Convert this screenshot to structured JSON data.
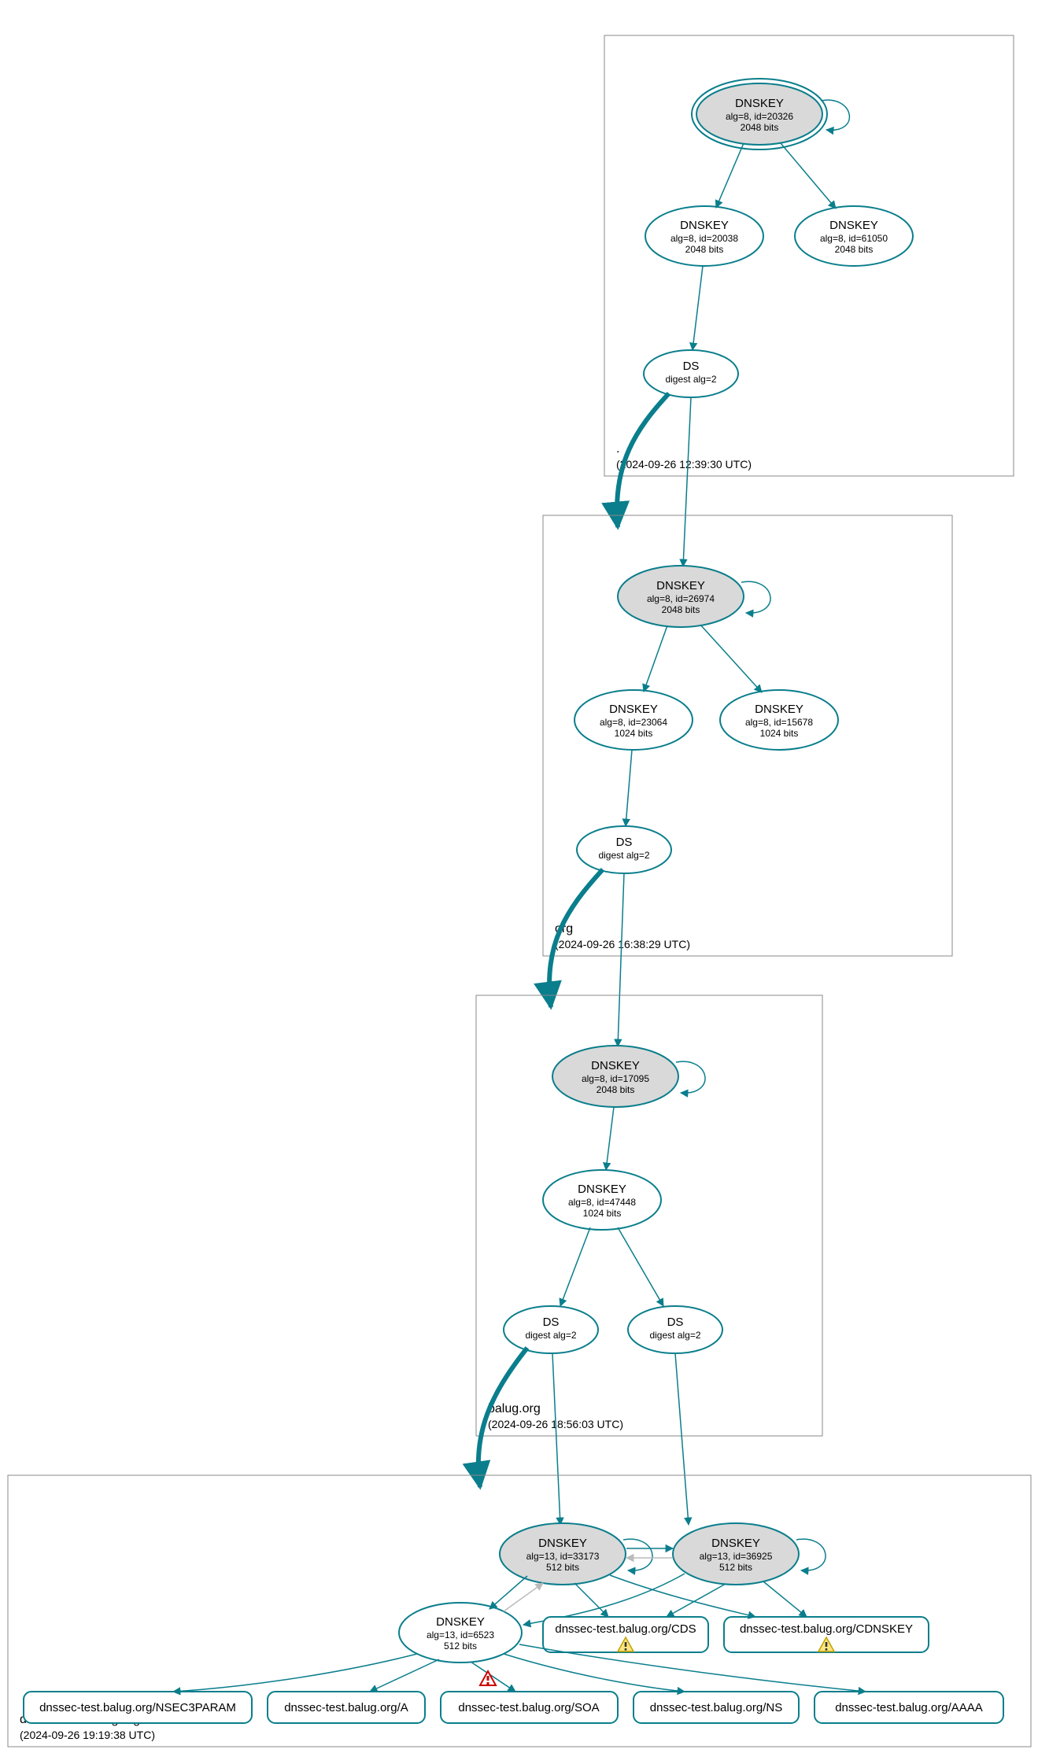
{
  "zones": {
    "root": {
      "label": ".",
      "timestamp": "(2024-09-26 12:39:30 UTC)",
      "nodes": {
        "ksk": {
          "l1": "DNSKEY",
          "l2": "alg=8, id=20326",
          "l3": "2048 bits"
        },
        "zsk1": {
          "l1": "DNSKEY",
          "l2": "alg=8, id=20038",
          "l3": "2048 bits"
        },
        "zsk2": {
          "l1": "DNSKEY",
          "l2": "alg=8, id=61050",
          "l3": "2048 bits"
        },
        "ds": {
          "l1": "DS",
          "l2": "digest alg=2"
        }
      }
    },
    "org": {
      "label": "org",
      "timestamp": "(2024-09-26 16:38:29 UTC)",
      "nodes": {
        "ksk": {
          "l1": "DNSKEY",
          "l2": "alg=8, id=26974",
          "l3": "2048 bits"
        },
        "zsk1": {
          "l1": "DNSKEY",
          "l2": "alg=8, id=23064",
          "l3": "1024 bits"
        },
        "zsk2": {
          "l1": "DNSKEY",
          "l2": "alg=8, id=15678",
          "l3": "1024 bits"
        },
        "ds": {
          "l1": "DS",
          "l2": "digest alg=2"
        }
      }
    },
    "balug": {
      "label": "balug.org",
      "timestamp": "(2024-09-26 18:56:03 UTC)",
      "nodes": {
        "ksk": {
          "l1": "DNSKEY",
          "l2": "alg=8, id=17095",
          "l3": "2048 bits"
        },
        "zsk": {
          "l1": "DNSKEY",
          "l2": "alg=8, id=47448",
          "l3": "1024 bits"
        },
        "ds1": {
          "l1": "DS",
          "l2": "digest alg=2"
        },
        "ds2": {
          "l1": "DS",
          "l2": "digest alg=2"
        }
      }
    },
    "dnssectest": {
      "label": "dnssec-test.balug.org",
      "timestamp": "(2024-09-26 19:19:38 UTC)",
      "nodes": {
        "ksk1": {
          "l1": "DNSKEY",
          "l2": "alg=13, id=33173",
          "l3": "512 bits"
        },
        "ksk2": {
          "l1": "DNSKEY",
          "l2": "alg=13, id=36925",
          "l3": "512 bits"
        },
        "zsk": {
          "l1": "DNSKEY",
          "l2": "alg=13, id=6523",
          "l3": "512 bits"
        }
      },
      "rrsets": {
        "cds": "dnssec-test.balug.org/CDS",
        "cdnskey": "dnssec-test.balug.org/CDNSKEY",
        "nsec3param": "dnssec-test.balug.org/NSEC3PARAM",
        "a": "dnssec-test.balug.org/A",
        "soa": "dnssec-test.balug.org/SOA",
        "ns": "dnssec-test.balug.org/NS",
        "aaaa": "dnssec-test.balug.org/AAAA"
      }
    }
  },
  "colors": {
    "accent": "#0a7e8c",
    "kskFill": "#d9d9d9",
    "box": "#888888",
    "warnFill": "#ffe680",
    "warnStroke": "#c0a000",
    "errFill": "#ff7070",
    "errStroke": "#aa0000"
  },
  "icons": {
    "warning": "warning-triangle",
    "error": "error-triangle"
  }
}
